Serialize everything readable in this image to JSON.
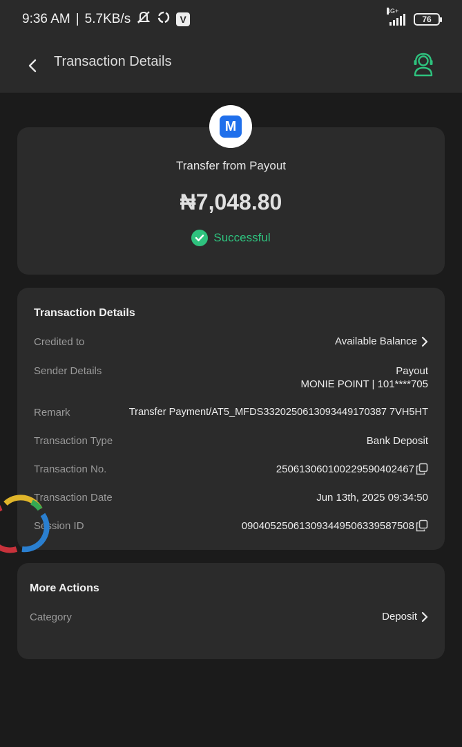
{
  "status_bar": {
    "time": "9:36 AM",
    "separator": "|",
    "network_speed": "5.7KB/s",
    "network_type": "4G+",
    "battery": "76"
  },
  "app_bar": {
    "title": "Transaction Details"
  },
  "summary": {
    "logo_letter": "M",
    "title": "Transfer from Payout",
    "amount": "₦7,048.80",
    "status": "Successful",
    "status_color": "#2ec27e"
  },
  "details": {
    "section_title": "Transaction Details",
    "credited_to_label": "Credited to",
    "credited_to_value": "Available Balance",
    "sender_label": "Sender Details",
    "sender_name": "Payout",
    "sender_bank": "MONIE POINT | 101****705",
    "remark_label": "Remark",
    "remark_value": "Transfer Payment/AT5_MFDS3320250613093449170387 7VH5HT",
    "type_label": "Transaction Type",
    "type_value": "Bank Deposit",
    "number_label": "Transaction No.",
    "number_value": "250613060100229590402467",
    "date_label": "Transaction Date",
    "date_value": "Jun 13th, 2025 09:34:50",
    "session_label": "Session ID",
    "session_value": "090405250613093449506339587508"
  },
  "more_actions": {
    "section_title": "More Actions",
    "category_label": "Category",
    "category_value": "Deposit"
  },
  "colors": {
    "background": "#1b1b1b",
    "card": "#2b2b2b",
    "accent_green": "#2ec27e",
    "brand_blue": "#1f6feb"
  }
}
